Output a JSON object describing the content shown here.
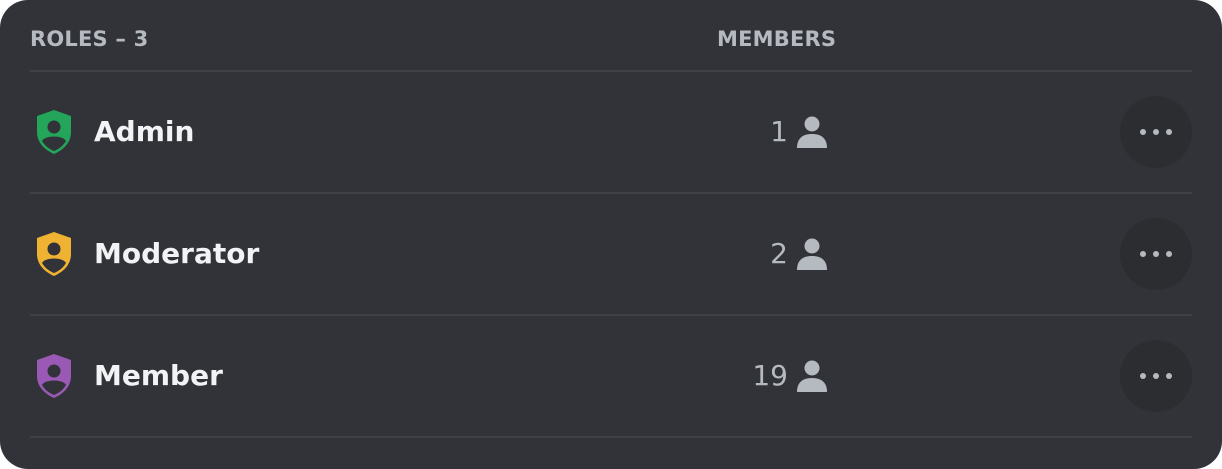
{
  "header": {
    "roles_label": "ROLES – 3",
    "members_label": "MEMBERS"
  },
  "roles": [
    {
      "name": "Admin",
      "members": "1",
      "color": "#23a55a",
      "icon": "role-shield-icon"
    },
    {
      "name": "Moderator",
      "members": "2",
      "color": "#f0b232",
      "icon": "role-shield-icon"
    },
    {
      "name": "Member",
      "members": "19",
      "color": "#9b59b6",
      "icon": "role-shield-icon"
    }
  ],
  "icons": {
    "members": "person-icon",
    "more": "more-options-icon"
  },
  "colors": {
    "background": "#313338",
    "text_primary": "#f2f3f5",
    "text_muted": "#b5bac1"
  }
}
